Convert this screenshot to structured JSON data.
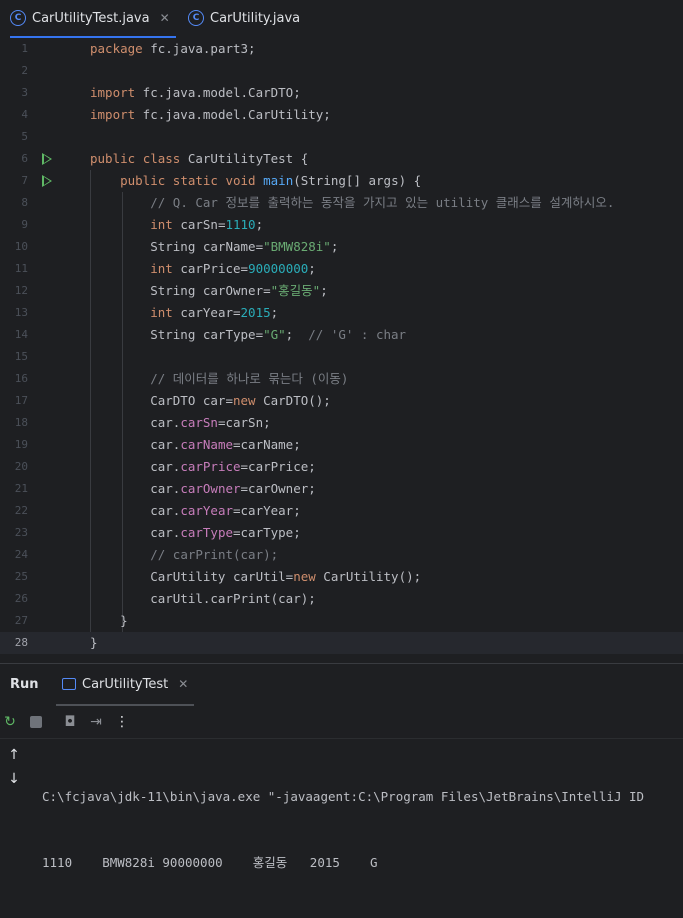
{
  "tabs": [
    {
      "label": "CarUtilityTest.java",
      "icon": "class-icon",
      "active": true
    },
    {
      "label": "CarUtility.java",
      "icon": "class-icon",
      "active": false
    }
  ],
  "editor": {
    "current_line": 28,
    "lines": [
      "package fc.java.part3;",
      "",
      "import fc.java.model.CarDTO;",
      "import fc.java.model.CarUtility;",
      "",
      "public class CarUtilityTest {",
      "    public static void main(String[] args) {",
      "        // Q. Car 정보를 출력하는 동작을 가지고 있는 utility 클래스를 설계하시오.",
      "        int carSn=1110;",
      "        String carName=\"BMW828i\";",
      "        int carPrice=90000000;",
      "        String carOwner=\"홍길동\";",
      "        int carYear=2015;",
      "        String carType=\"G\";  // 'G' : char",
      "",
      "        // 데이터를 하나로 묶는다 (이동)",
      "        CarDTO car=new CarDTO();",
      "        car.carSn=carSn;",
      "        car.carName=carName;",
      "        car.carPrice=carPrice;",
      "        car.carOwner=carOwner;",
      "        car.carYear=carYear;",
      "        car.carType=carType;",
      "        // carPrint(car);",
      "        CarUtility carUtil=new CarUtility();",
      "        carUtil.carPrint(car);",
      "    }",
      "}"
    ],
    "run_gutter_lines": [
      6,
      7
    ]
  },
  "run_panel": {
    "title": "Run",
    "tab_label": "CarUtilityTest",
    "toolbar_icons": [
      "rerun-icon",
      "stop-icon",
      "camera-icon",
      "exit-icon",
      "more-icon"
    ],
    "console_lines": [
      "C:\\fcjava\\jdk-11\\bin\\java.exe \"-javaagent:C:\\Program Files\\JetBrains\\IntelliJ ID",
      "1110    BMW828i 90000000    홍길동   2015    G"
    ]
  },
  "colors": {
    "background": "#1e1f22",
    "keyword": "#cf8e6d",
    "string": "#6aab73",
    "number": "#2aacb8",
    "comment": "#7a7e85",
    "field": "#c77dbb",
    "method": "#56a8f5",
    "accent": "#3574f0"
  }
}
